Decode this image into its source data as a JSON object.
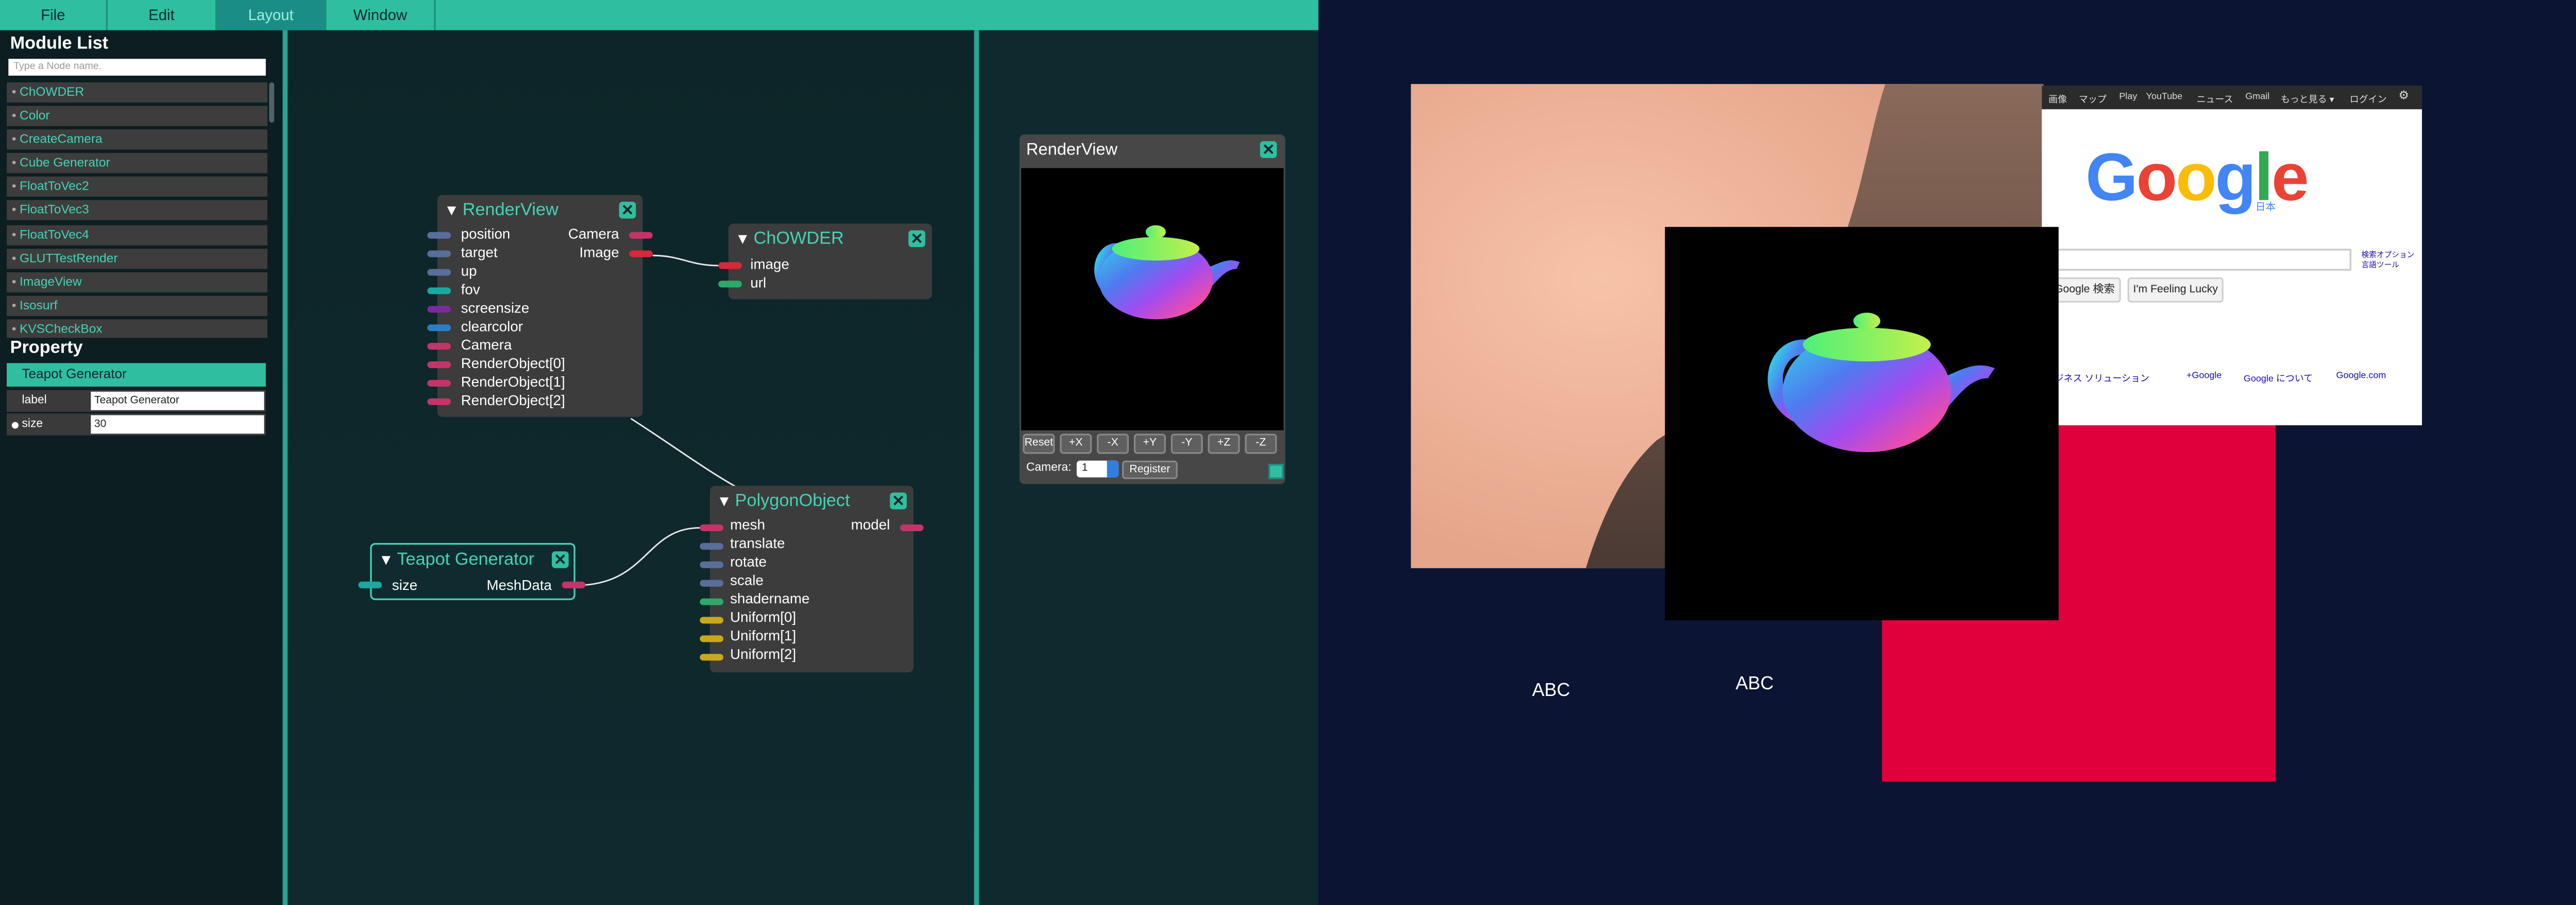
{
  "menubar": {
    "items": [
      "File",
      "Edit",
      "Layout",
      "Window"
    ],
    "active": "Layout"
  },
  "sidebar": {
    "module_list_title": "Module List",
    "search_placeholder": "Type a Node name.",
    "modules": [
      "ChOWDER",
      "Color",
      "CreateCamera",
      "Cube Generator",
      "FloatToVec2",
      "FloatToVec3",
      "FloatToVec4",
      "GLUTTestRender",
      "ImageView",
      "Isosurf",
      "KVSCheckBox"
    ],
    "property_title": "Property",
    "selected_node": "Teapot Generator",
    "properties": [
      {
        "key": "label",
        "value": "Teapot Generator"
      },
      {
        "key": "size",
        "value": "30"
      }
    ]
  },
  "nodes": {
    "render_view": {
      "title": "RenderView",
      "inputs": [
        "position",
        "target",
        "up",
        "fov",
        "screensize",
        "clearcolor",
        "Camera",
        "RenderObject[0]",
        "RenderObject[1]",
        "RenderObject[2]"
      ],
      "outputs": [
        "Camera",
        "Image"
      ]
    },
    "chowder": {
      "title": "ChOWDER",
      "inputs": [
        "image",
        "url"
      ]
    },
    "polygon_object": {
      "title": "PolygonObject",
      "inputs": [
        "mesh",
        "translate",
        "rotate",
        "scale",
        "shadername",
        "Uniform[0]",
        "Uniform[1]",
        "Uniform[2]"
      ],
      "outputs": [
        "model"
      ]
    },
    "teapot_generator": {
      "title": "Teapot Generator",
      "inputs": [
        "size"
      ],
      "outputs": [
        "MeshData"
      ]
    }
  },
  "render_panel": {
    "title": "RenderView",
    "buttons": [
      "Reset",
      "+X",
      "-X",
      "+Y",
      "-Y",
      "+Z",
      "-Z"
    ],
    "camera_label": "Camera:",
    "camera_value": "1",
    "register_label": "Register"
  },
  "display": {
    "google": {
      "topbar": [
        "画像",
        "マップ",
        "Play",
        "YouTube",
        "ニュース",
        "Gmail",
        "もっと見る ▾",
        "ログイン"
      ],
      "logo_letters": [
        "G",
        "o",
        "o",
        "g",
        "l",
        "e"
      ],
      "logo_colors": [
        "#4285f4",
        "#ea4335",
        "#fbbc05",
        "#4285f4",
        "#34a853",
        "#ea4335"
      ],
      "logo_sub": "日本",
      "search_options": [
        "検索オプション",
        "言語ツール"
      ],
      "search_button": "Google 検索",
      "lucky_button": "I'm Feeling Lucky",
      "footer_links": [
        "ビジネス ソリューション",
        "+Google",
        "Google について",
        "Google.com"
      ]
    },
    "labels": [
      "ABC",
      "ABC"
    ]
  },
  "colors": {
    "accent": "#2fbfa0",
    "node_title": "#44d3b7",
    "pin_blue": "#5a6e9c",
    "pin_teal": "#1aa8a2",
    "pin_purple": "#7b2a9c",
    "pin_cyan": "#2a7ec8",
    "pin_magenta": "#c2346a",
    "pin_red": "#d8283a",
    "pin_green": "#2fa86a",
    "pin_yellow": "#c9a81e",
    "red_rect": "#e0003b"
  }
}
